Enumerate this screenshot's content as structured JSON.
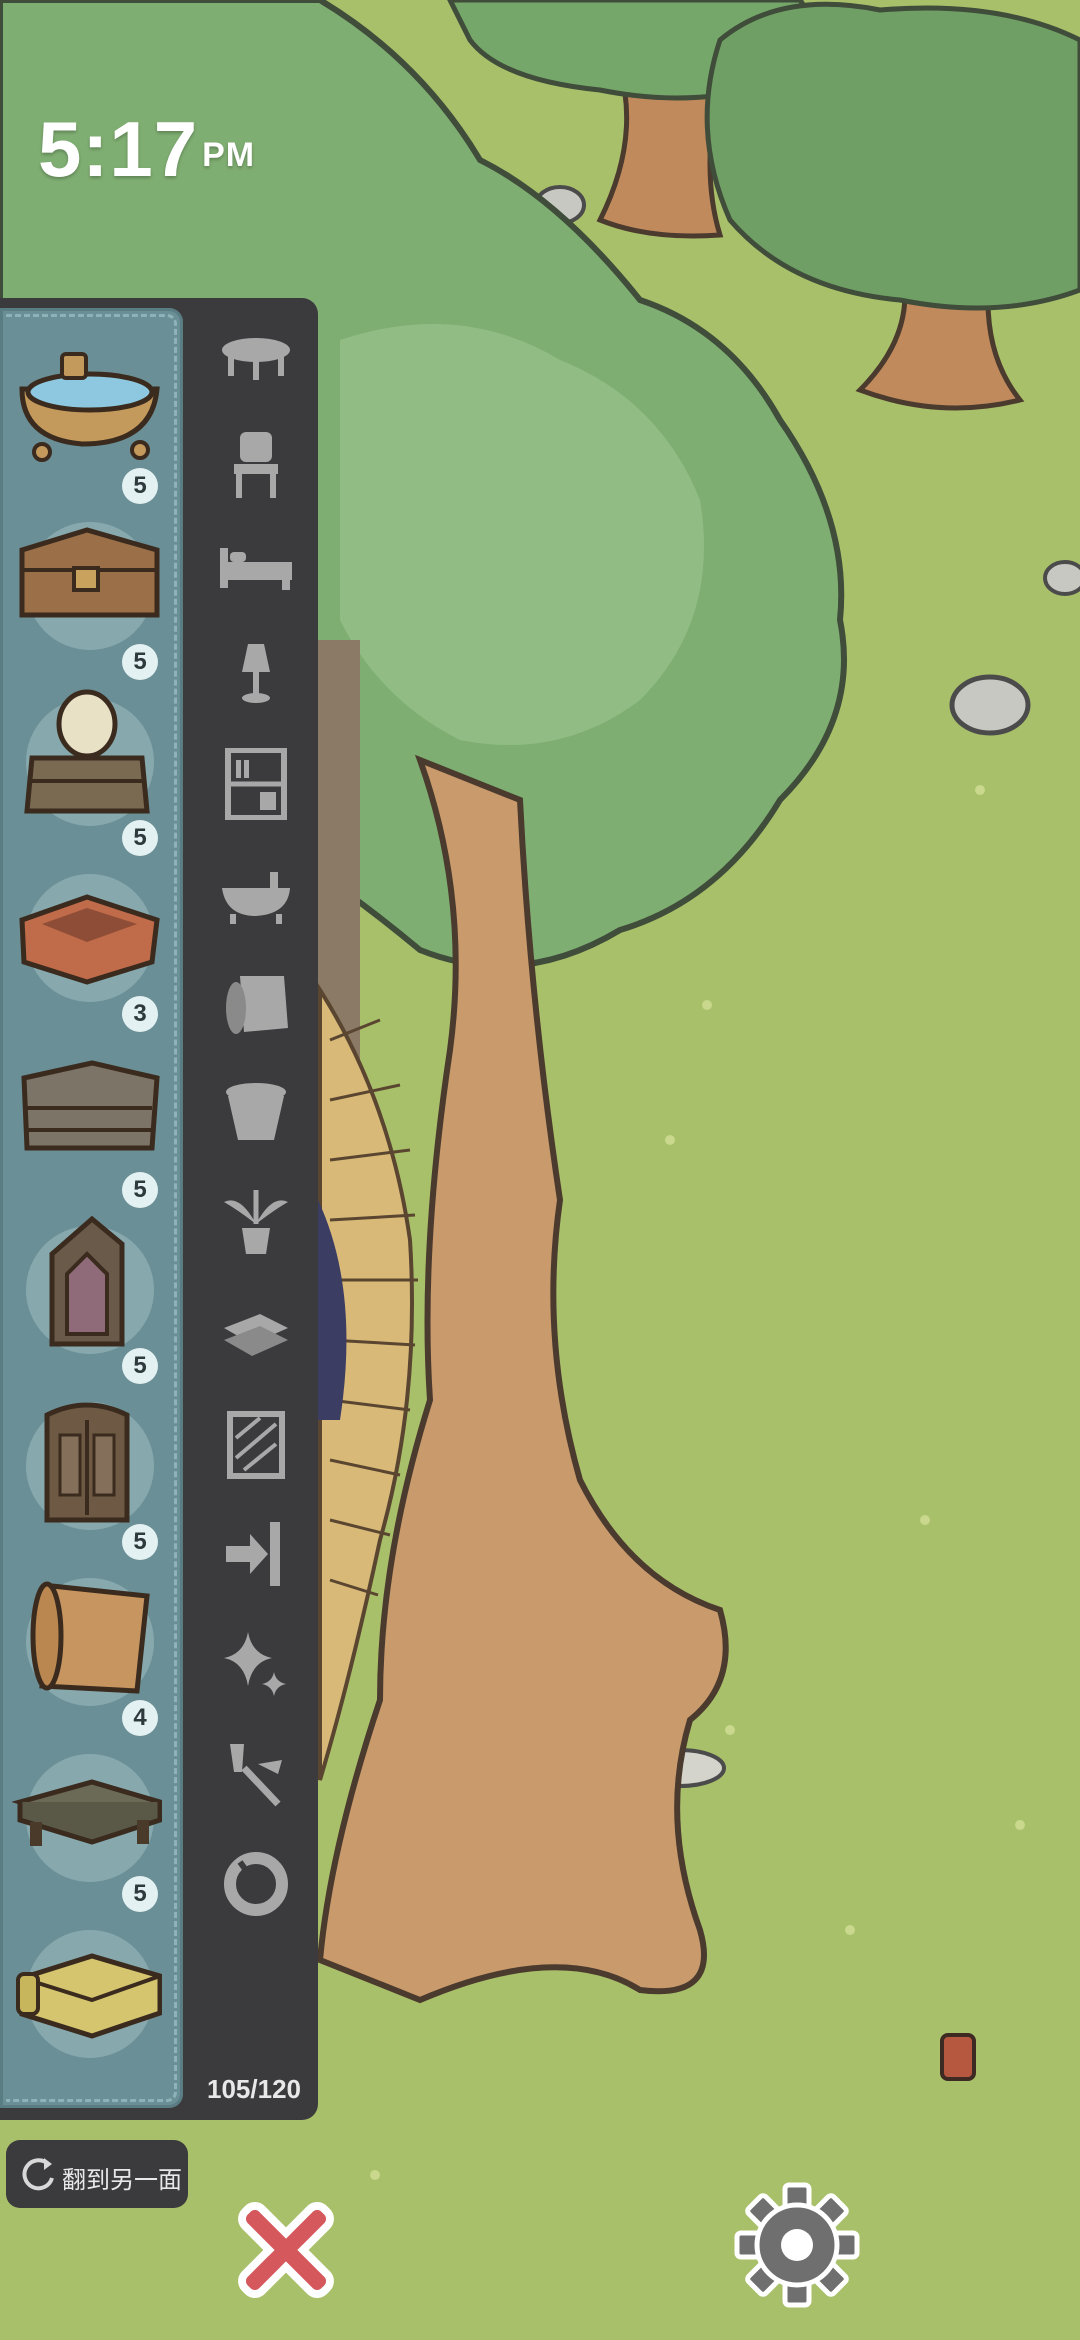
{
  "status_bar": {
    "time": "5:17",
    "ampm": "PM"
  },
  "inventory": {
    "items": [
      {
        "icon": "bathtub-icon",
        "count": "5"
      },
      {
        "icon": "chest-icon",
        "count": "5"
      },
      {
        "icon": "vanity-mirror-icon",
        "count": "5"
      },
      {
        "icon": "tray-icon",
        "count": "3"
      },
      {
        "icon": "dresser-icon",
        "count": "5"
      },
      {
        "icon": "shrine-cabinet-icon",
        "count": "5"
      },
      {
        "icon": "wardrobe-icon",
        "count": "5"
      },
      {
        "icon": "rug-scroll-icon",
        "count": "4"
      },
      {
        "icon": "low-table-icon",
        "count": "5"
      },
      {
        "icon": "sofa-icon",
        "count": ""
      }
    ],
    "categories": [
      "table-icon",
      "chair-icon",
      "bed-icon",
      "lamp-icon",
      "bookshelf-icon",
      "bathtub-icon",
      "rug-icon",
      "pot-icon",
      "plant-icon",
      "planks-icon",
      "wallpaper-icon",
      "door-icon",
      "sparkle-icon",
      "tools-icon",
      "ring-icon"
    ],
    "capacity": "105/120"
  },
  "flip_button": {
    "label": "翻到另一面",
    "icon": "rotate-icon"
  },
  "close_button": {
    "icon": "close-icon",
    "color": "#d5595c"
  },
  "settings_button": {
    "icon": "gear-icon",
    "color": "#6f6f6f"
  }
}
